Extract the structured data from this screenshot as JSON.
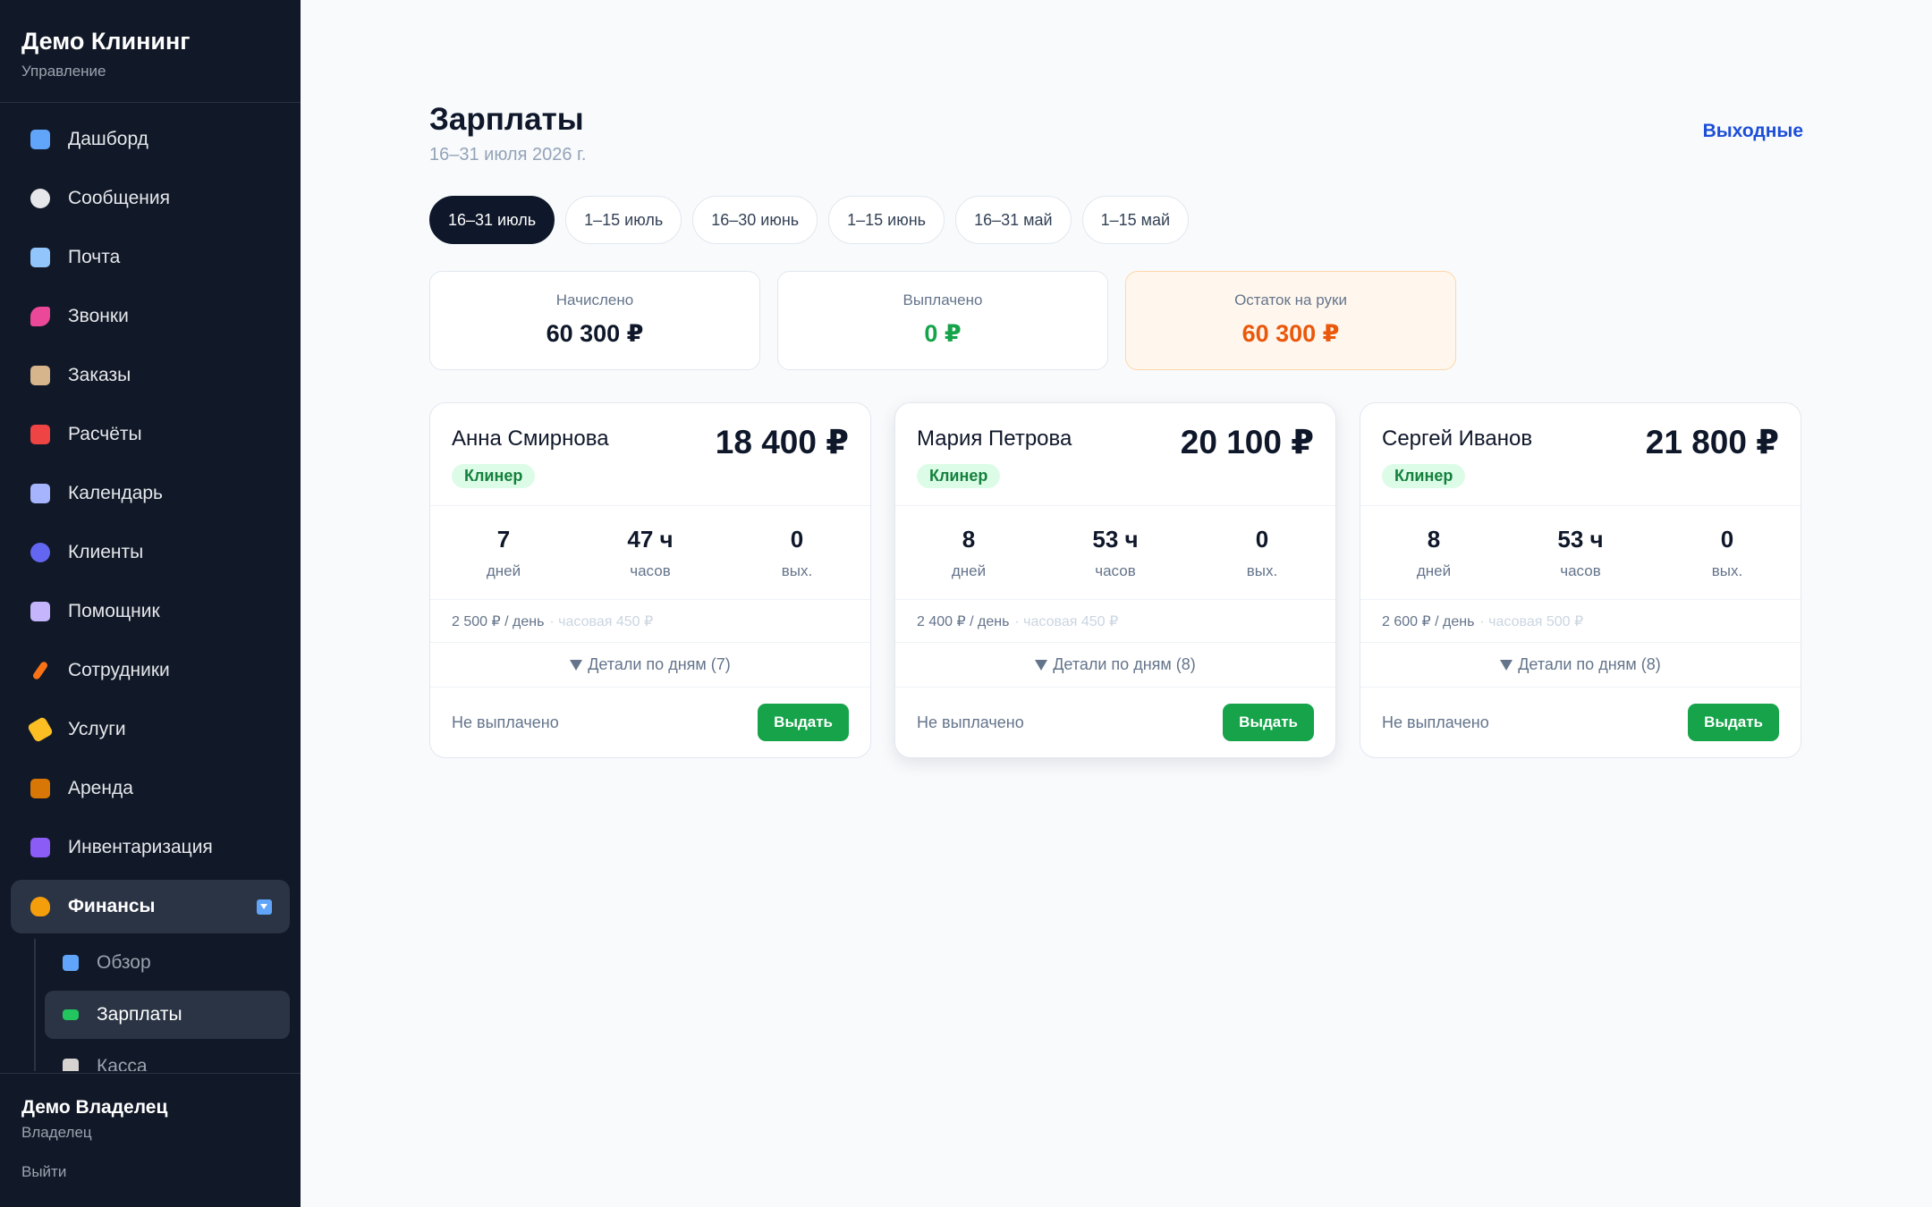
{
  "app": {
    "title": "Демо Клининг",
    "subtitle": "Управление"
  },
  "sidebar": {
    "items": [
      {
        "label": "Дашборд",
        "icon": "chart-icon",
        "color": "#60a5fa"
      },
      {
        "label": "Сообщения",
        "icon": "chat-bubble-icon",
        "color": "#e5e7eb"
      },
      {
        "label": "Почта",
        "icon": "mail-icon",
        "color": "#93c5fd"
      },
      {
        "label": "Звонки",
        "icon": "phone-icon",
        "color": "#ec4899"
      },
      {
        "label": "Заказы",
        "icon": "clipboard-icon",
        "color": "#d6b48c"
      },
      {
        "label": "Расчёты",
        "icon": "abacus-icon",
        "color": "#ef4444"
      },
      {
        "label": "Календарь",
        "icon": "calendar-icon",
        "color": "#a5b4fc"
      },
      {
        "label": "Клиенты",
        "icon": "users-icon",
        "color": "#6366f1"
      },
      {
        "label": "Помощник",
        "icon": "robot-icon",
        "color": "#c4b5fd"
      },
      {
        "label": "Сотрудники",
        "icon": "broom-icon",
        "color": "#f97316"
      },
      {
        "label": "Услуги",
        "icon": "tag-icon",
        "color": "#fbbf24"
      },
      {
        "label": "Аренда",
        "icon": "box-icon",
        "color": "#d97706"
      },
      {
        "label": "Инвентаризация",
        "icon": "cabinet-icon",
        "color": "#8b5cf6"
      }
    ],
    "finance": {
      "label": "Финансы",
      "icon": "money-bag-icon",
      "children": [
        {
          "label": "Обзор",
          "icon": "chart-icon",
          "color": "#60a5fa"
        },
        {
          "label": "Зарплаты",
          "icon": "banknote-icon",
          "color": "#22c55e"
        },
        {
          "label": "Касса",
          "icon": "bank-icon",
          "color": "#d6d3d1"
        }
      ]
    },
    "user": {
      "name": "Демо Владелец",
      "role": "Владелец",
      "logout": "Выйти"
    }
  },
  "page": {
    "title": "Зарплаты",
    "subtitle": "16–31 июля 2026 г.",
    "weekends_link": "Выходные"
  },
  "periods": [
    "16–31 июль",
    "1–15 июль",
    "16–30 июнь",
    "1–15 июнь",
    "16–31 май",
    "1–15 май"
  ],
  "summary": {
    "accrued": {
      "label": "Начислено",
      "value": "60 300 ₽"
    },
    "paid": {
      "label": "Выплачено",
      "value": "0 ₽"
    },
    "balance": {
      "label": "Остаток на руки",
      "value": "60 300 ₽"
    }
  },
  "employees": [
    {
      "name": "Анна Смирнова",
      "role": "Клинер",
      "total": "18 400 ₽",
      "days": "7",
      "days_unit": "дней",
      "hours": "47 ч",
      "hours_unit": "часов",
      "off": "0",
      "off_unit": "вых.",
      "daily_rate": "2 500 ₽ / день",
      "hourly_rate": "· часовая 450 ₽",
      "details": "Детали по дням (7)",
      "status": "Не выплачено",
      "pay_label": "Выдать"
    },
    {
      "name": "Мария Петрова",
      "role": "Клинер",
      "total": "20 100 ₽",
      "days": "8",
      "days_unit": "дней",
      "hours": "53 ч",
      "hours_unit": "часов",
      "off": "0",
      "off_unit": "вых.",
      "daily_rate": "2 400 ₽ / день",
      "hourly_rate": "· часовая 450 ₽",
      "details": "Детали по дням (8)",
      "status": "Не выплачено",
      "pay_label": "Выдать"
    },
    {
      "name": "Сергей Иванов",
      "role": "Клинер",
      "total": "21 800 ₽",
      "days": "8",
      "days_unit": "дней",
      "hours": "53 ч",
      "hours_unit": "часов",
      "off": "0",
      "off_unit": "вых.",
      "daily_rate": "2 600 ₽ / день",
      "hourly_rate": "· часовая 500 ₽",
      "details": "Детали по дням (8)",
      "status": "Не выплачено",
      "pay_label": "Выдать"
    }
  ],
  "colors": {
    "accent": "#1d4ed8",
    "success": "#16a34a",
    "warning": "#ea580c",
    "sidebar_bg": "#111827"
  }
}
